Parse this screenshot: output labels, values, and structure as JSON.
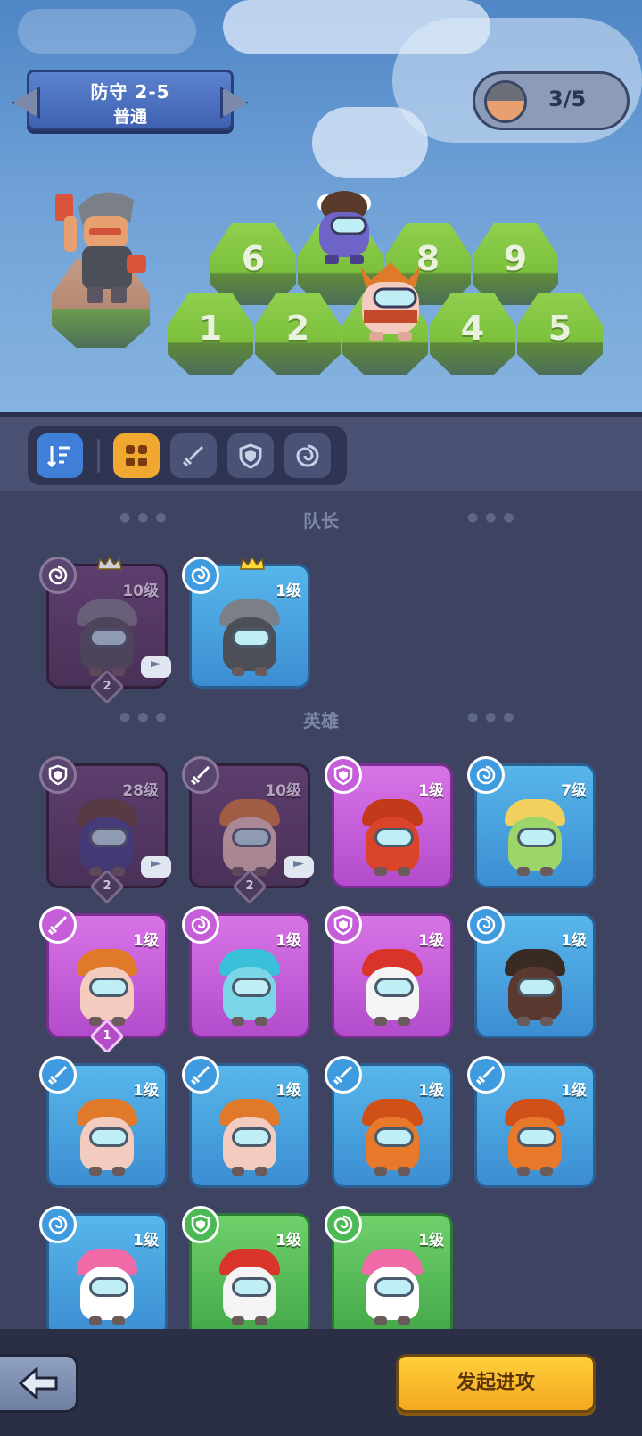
{
  "stage": {
    "title": "防守 2-5",
    "difficulty": "普通"
  },
  "leader_counter": {
    "value": "3/5"
  },
  "board": {
    "slots": [
      "6",
      "8",
      "9",
      "1",
      "2",
      "4",
      "5"
    ]
  },
  "toolbar": {
    "items": [
      "sort-icon",
      "grid-icon",
      "sword-icon",
      "shield-icon",
      "swirl-icon"
    ],
    "active": "grid-icon"
  },
  "sections": {
    "captain": "队长",
    "heroes": "英雄"
  },
  "captains": [
    {
      "level": "10级",
      "color": "dim",
      "class": "swirl-icon",
      "position": "2"
    },
    {
      "level": "1级",
      "color": "blue",
      "class": "swirl-icon"
    }
  ],
  "heroes": [
    {
      "level": "28级",
      "color": "dim",
      "class": "shield-icon",
      "position": "2"
    },
    {
      "level": "10级",
      "color": "dim",
      "class": "sword-icon",
      "position": "2"
    },
    {
      "level": "1级",
      "color": "purple",
      "class": "shield-icon"
    },
    {
      "level": "7级",
      "color": "blue",
      "class": "swirl-icon"
    },
    {
      "level": "1级",
      "color": "purple",
      "class": "sword-icon",
      "position": "1"
    },
    {
      "level": "1级",
      "color": "purple",
      "class": "swirl-icon"
    },
    {
      "level": "1级",
      "color": "purple",
      "class": "shield-icon"
    },
    {
      "level": "1级",
      "color": "blue",
      "class": "swirl-icon"
    },
    {
      "level": "1级",
      "color": "blue",
      "class": "sword-icon"
    },
    {
      "level": "1级",
      "color": "blue",
      "class": "sword-icon"
    },
    {
      "level": "1级",
      "color": "blue",
      "class": "sword-icon"
    },
    {
      "level": "1级",
      "color": "blue",
      "class": "sword-icon"
    },
    {
      "level": "1级",
      "color": "blue",
      "class": "swirl-icon"
    },
    {
      "level": "1级",
      "color": "green",
      "class": "shield-icon"
    },
    {
      "level": "1级",
      "color": "green",
      "class": "swirl-icon"
    }
  ],
  "footer": {
    "attack_label": "发起进攻"
  },
  "colors": {
    "card_blue": "#3c8ed2",
    "card_purple": "#b24ccc",
    "card_green": "#44a84a",
    "button_yellow": "#f4a820"
  }
}
